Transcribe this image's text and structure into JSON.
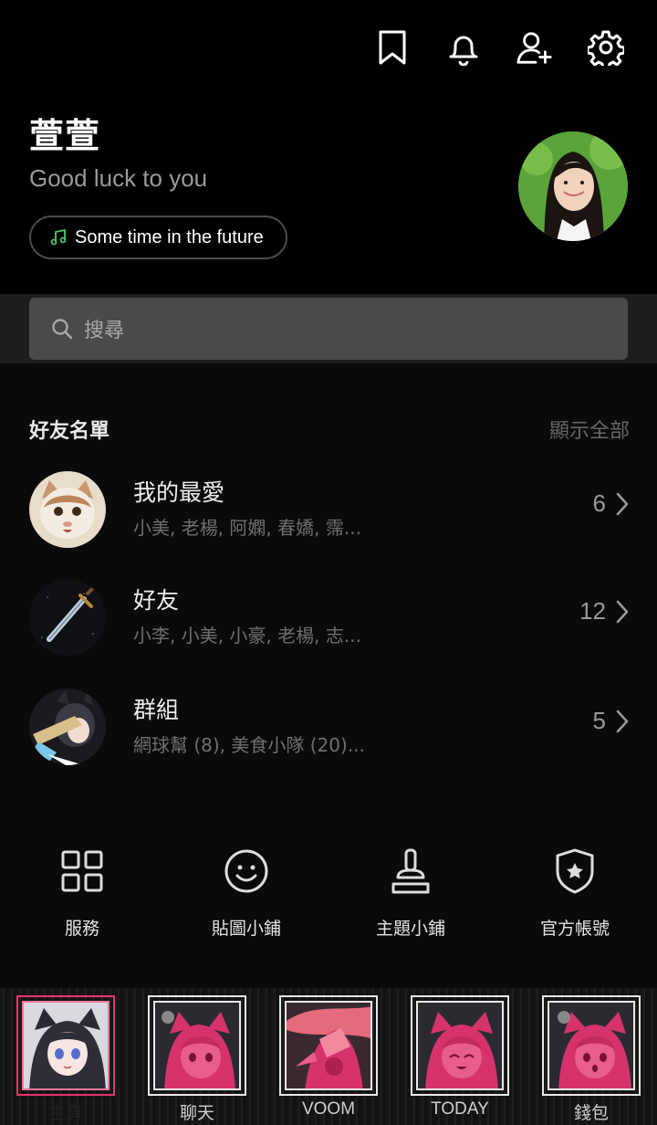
{
  "header": {
    "icons": [
      "bookmark-icon",
      "bell-icon",
      "add-friend-icon",
      "gear-icon"
    ]
  },
  "profile": {
    "name": "萱萱",
    "status": "Good luck to you",
    "music": "Some time in the future"
  },
  "search": {
    "placeholder": "搜尋"
  },
  "friends_section": {
    "title": "好友名單",
    "show_all": "顯示全部",
    "rows": [
      {
        "title": "我的最愛",
        "sub": "小美, 老楊, 阿嫻, 春嬌, 霈...",
        "count": "6"
      },
      {
        "title": "好友",
        "sub": "小李, 小美, 小豪, 老楊, 志...",
        "count": "12"
      },
      {
        "title": "群組",
        "sub": "網球幫 (8), 美食小隊 (20)...",
        "count": "5"
      }
    ]
  },
  "services": [
    {
      "label": "服務",
      "icon": "grid-icon"
    },
    {
      "label": "貼圖小鋪",
      "icon": "smiley-icon"
    },
    {
      "label": "主題小鋪",
      "icon": "brush-icon"
    },
    {
      "label": "官方帳號",
      "icon": "shield-star-icon"
    }
  ],
  "tabs": [
    {
      "label": "主頁",
      "active": true
    },
    {
      "label": "聊天",
      "active": false
    },
    {
      "label": "VOOM",
      "active": false
    },
    {
      "label": "TODAY",
      "active": false
    },
    {
      "label": "錢包",
      "active": false
    }
  ],
  "colors": {
    "accent_active_tab": "#e8356c",
    "music_note": "#4cc764"
  }
}
